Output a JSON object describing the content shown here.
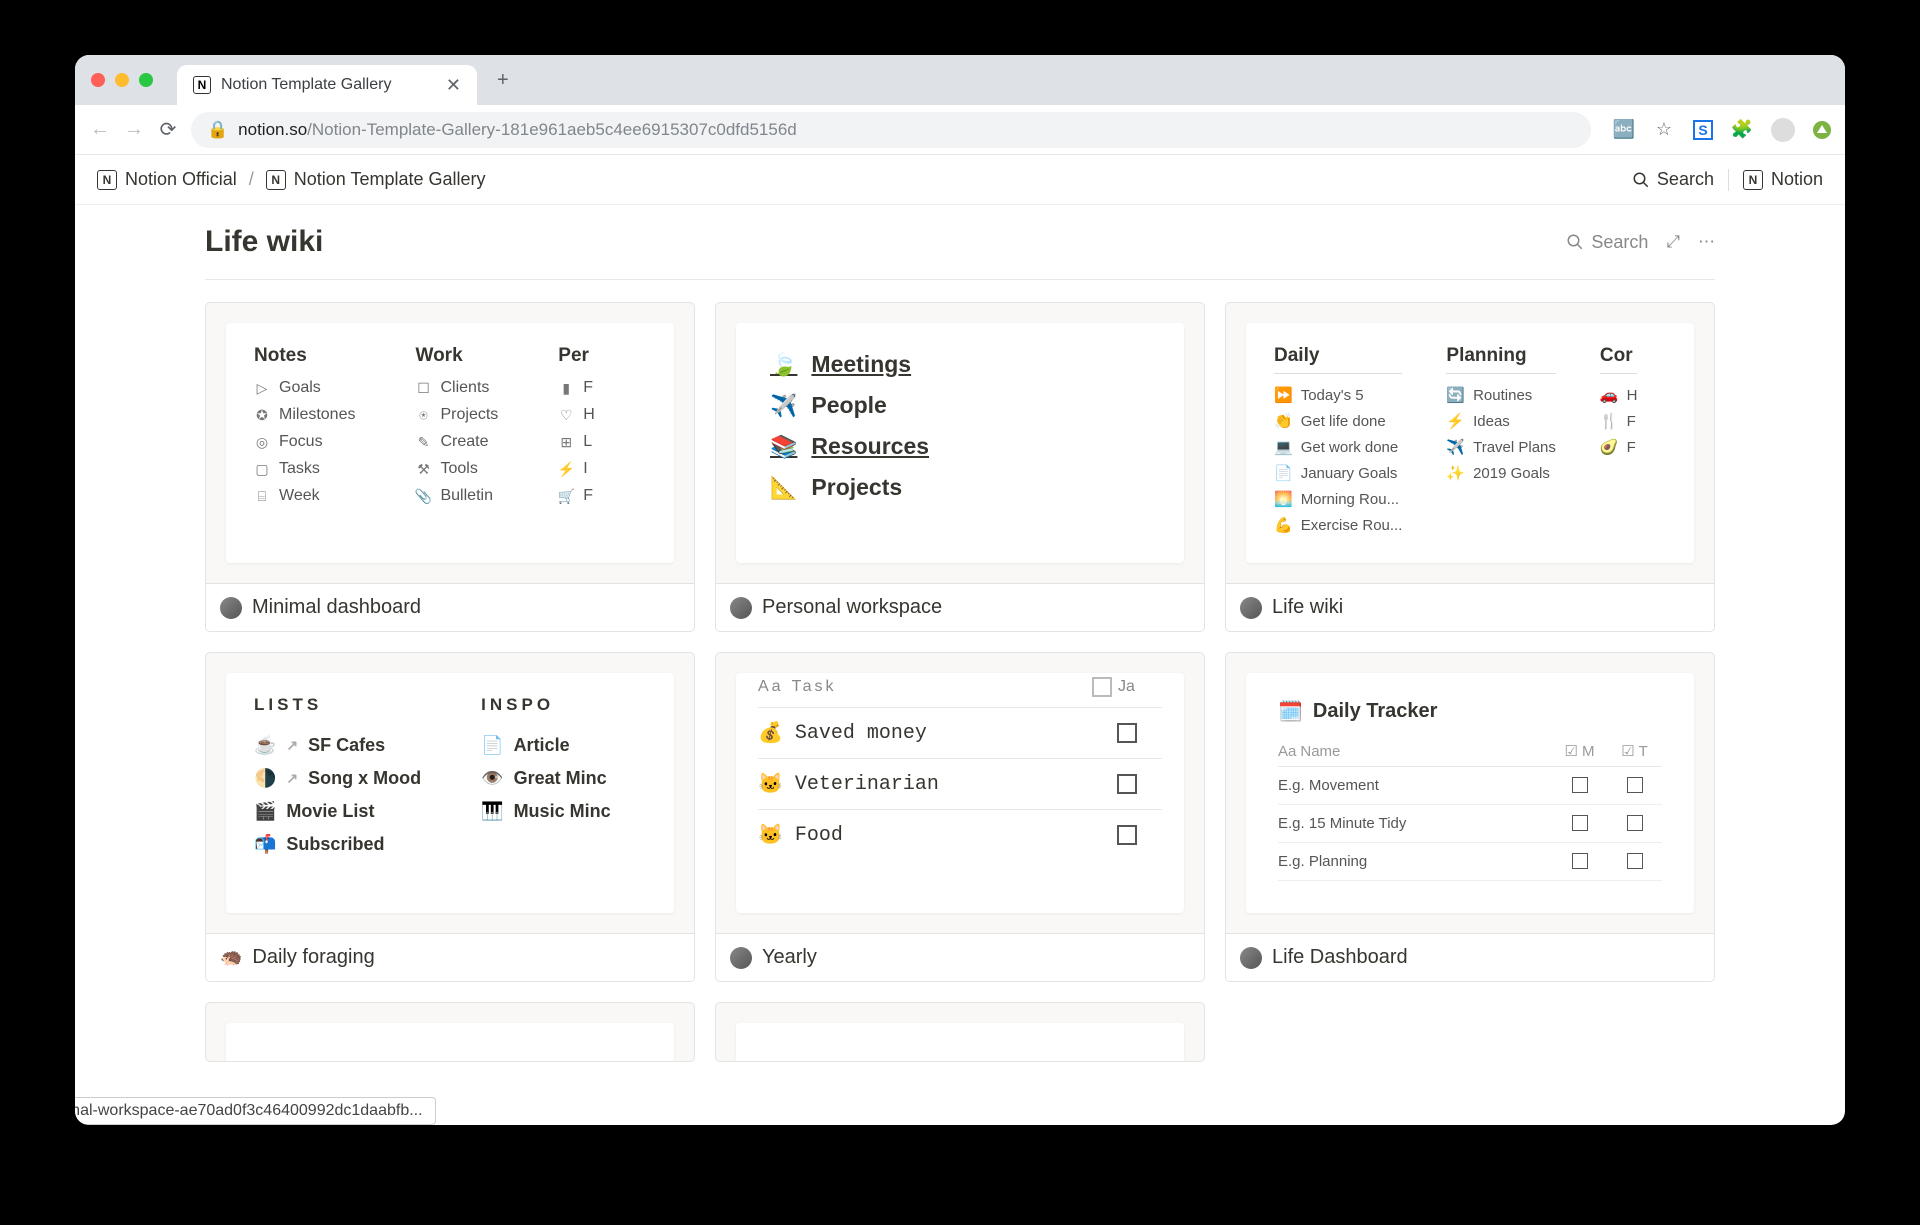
{
  "browser": {
    "tab_title": "Notion Template Gallery",
    "url_host": "notion.so",
    "url_path": "/Notion-Template-Gallery-181e961aeb5c4ee6915307c0dfd5156d",
    "status_url": "notion.so/Personal-workspace-ae70ad0f3c46400992dc1daabfb..."
  },
  "breadcrumb": {
    "root": "Notion Official",
    "current": "Notion Template Gallery",
    "search_label": "Search",
    "notion_label": "Notion"
  },
  "page": {
    "title": "Life wiki",
    "search_label": "Search"
  },
  "cards": [
    {
      "id": "minimal-dashboard",
      "title": "Minimal dashboard",
      "type": "cols3",
      "columns": [
        {
          "heading": "Notes",
          "items": [
            {
              "icon": "▷",
              "label": "Goals"
            },
            {
              "icon": "✪",
              "label": "Milestones"
            },
            {
              "icon": "◎",
              "label": "Focus"
            },
            {
              "icon": "▢",
              "label": "Tasks"
            },
            {
              "icon": "⌸",
              "label": "Week"
            }
          ]
        },
        {
          "heading": "Work",
          "items": [
            {
              "icon": "☐",
              "label": "Clients"
            },
            {
              "icon": "⍟",
              "label": "Projects"
            },
            {
              "icon": "✎",
              "label": "Create"
            },
            {
              "icon": "⚒",
              "label": "Tools"
            },
            {
              "icon": "📎",
              "label": "Bulletin"
            }
          ]
        },
        {
          "heading": "Per",
          "items": [
            {
              "icon": "▮",
              "label": "F"
            },
            {
              "icon": "♡",
              "label": "H"
            },
            {
              "icon": "⊞",
              "label": "L"
            },
            {
              "icon": "⚡",
              "label": "I"
            },
            {
              "icon": "🛒",
              "label": "F"
            }
          ]
        }
      ]
    },
    {
      "id": "personal-workspace",
      "title": "Personal workspace",
      "type": "pw-list",
      "items": [
        {
          "emoji": "🍃",
          "label": "Meetings",
          "underlined": true
        },
        {
          "emoji": "✈️",
          "label": "People"
        },
        {
          "emoji": "📚",
          "label": "Resources",
          "underlined": true
        },
        {
          "emoji": "📐",
          "label": "Projects"
        }
      ]
    },
    {
      "id": "life-wiki",
      "title": "Life wiki",
      "type": "lw-cols",
      "columns": [
        {
          "heading": "Daily",
          "items": [
            {
              "emoji": "⏩",
              "label": "Today's 5"
            },
            {
              "emoji": "👏",
              "label": "Get life done"
            },
            {
              "emoji": "💻",
              "label": "Get work done"
            },
            {
              "emoji": "📄",
              "label": "January Goals"
            },
            {
              "emoji": "🌅",
              "label": "Morning Rou..."
            },
            {
              "emoji": "💪",
              "label": "Exercise Rou..."
            }
          ]
        },
        {
          "heading": "Planning",
          "items": [
            {
              "emoji": "🔄",
              "label": "Routines"
            },
            {
              "emoji": "⚡",
              "label": "Ideas"
            },
            {
              "emoji": "✈️",
              "label": "Travel Plans"
            },
            {
              "emoji": "✨",
              "label": "2019 Goals"
            }
          ]
        },
        {
          "heading": "Cor",
          "items": [
            {
              "emoji": "🚗",
              "label": "H"
            },
            {
              "emoji": "🍴",
              "label": "F"
            },
            {
              "emoji": "🥑",
              "label": "F"
            }
          ]
        }
      ]
    },
    {
      "id": "daily-foraging",
      "title": "Daily foraging",
      "type": "df-cols",
      "columns": [
        {
          "heading": "LISTS",
          "items": [
            {
              "emoji": "☕",
              "arrow": true,
              "label": "SF Cafes"
            },
            {
              "emoji": "🌗",
              "arrow": true,
              "label": "Song x Mood"
            },
            {
              "emoji": "🎬",
              "arrow": false,
              "label": "Movie List"
            },
            {
              "emoji": "📬",
              "arrow": false,
              "label": "Subscribed"
            }
          ]
        },
        {
          "heading": "INSPO",
          "items": [
            {
              "emoji": "📄",
              "arrow": false,
              "label": "Article"
            },
            {
              "emoji": "👁️",
              "arrow": false,
              "label": "Great Minc"
            },
            {
              "emoji": "🎹",
              "arrow": false,
              "label": "Music Minc"
            }
          ]
        }
      ]
    },
    {
      "id": "yearly",
      "title": "Yearly",
      "type": "yearly",
      "header": {
        "col1_icon": "Aa",
        "col1": "Task",
        "col2_icon": "☑",
        "col2": "Ja"
      },
      "rows": [
        {
          "emoji": "💰",
          "label": "Saved money"
        },
        {
          "emoji": "🐱",
          "label": "Veterinarian"
        },
        {
          "emoji": "🐱",
          "label": "Food"
        }
      ]
    },
    {
      "id": "life-dashboard",
      "title": "Life Dashboard",
      "type": "daily-tracker",
      "tracker_title": "Daily Tracker",
      "header": {
        "name_icon": "Aa",
        "name": "Name",
        "m_icon": "☑",
        "m": "M",
        "t_icon": "☑",
        "t": "T"
      },
      "rows": [
        {
          "label": "E.g. Movement"
        },
        {
          "label": "E.g. 15 Minute Tidy"
        },
        {
          "label": "E.g. Planning"
        }
      ]
    }
  ]
}
